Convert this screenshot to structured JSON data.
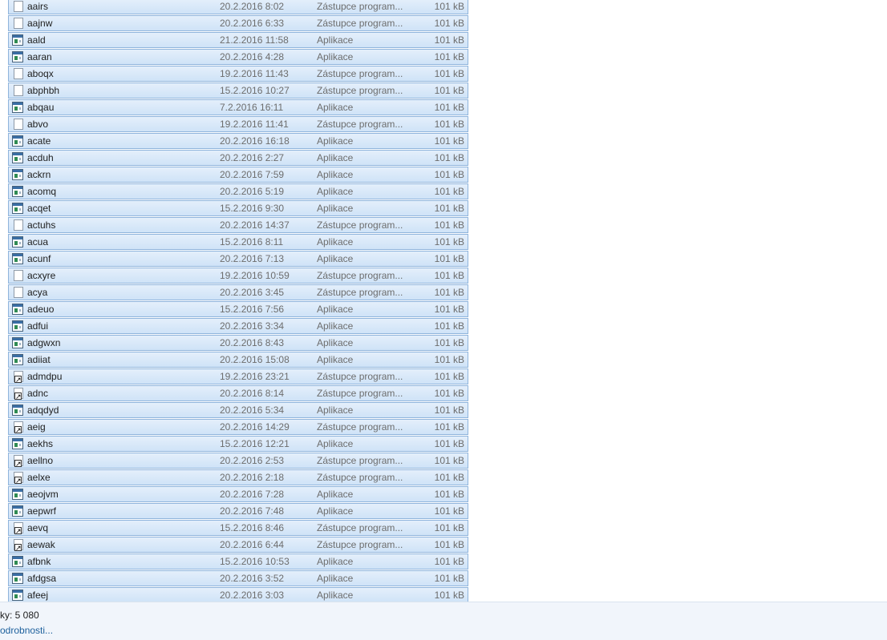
{
  "files": [
    {
      "name": "aairs",
      "date": "20.2.2016 8:02",
      "type": "Zástupce program...",
      "size": "101 kB",
      "icon": "document-icon"
    },
    {
      "name": "aajnw",
      "date": "20.2.2016 6:33",
      "type": "Zástupce program...",
      "size": "101 kB",
      "icon": "document-icon"
    },
    {
      "name": "aald",
      "date": "21.2.2016 11:58",
      "type": "Aplikace",
      "size": "101 kB",
      "icon": "application-icon"
    },
    {
      "name": "aaran",
      "date": "20.2.2016 4:28",
      "type": "Aplikace",
      "size": "101 kB",
      "icon": "application-icon"
    },
    {
      "name": "aboqx",
      "date": "19.2.2016 11:43",
      "type": "Zástupce program...",
      "size": "101 kB",
      "icon": "document-icon"
    },
    {
      "name": "abphbh",
      "date": "15.2.2016 10:27",
      "type": "Zástupce program...",
      "size": "101 kB",
      "icon": "document-icon"
    },
    {
      "name": "abqau",
      "date": "7.2.2016 16:11",
      "type": "Aplikace",
      "size": "101 kB",
      "icon": "application-icon"
    },
    {
      "name": "abvo",
      "date": "19.2.2016 11:41",
      "type": "Zástupce program...",
      "size": "101 kB",
      "icon": "document-icon"
    },
    {
      "name": "acate",
      "date": "20.2.2016 16:18",
      "type": "Aplikace",
      "size": "101 kB",
      "icon": "application-icon"
    },
    {
      "name": "acduh",
      "date": "20.2.2016 2:27",
      "type": "Aplikace",
      "size": "101 kB",
      "icon": "application-icon"
    },
    {
      "name": "ackrn",
      "date": "20.2.2016 7:59",
      "type": "Aplikace",
      "size": "101 kB",
      "icon": "application-icon"
    },
    {
      "name": "acomq",
      "date": "20.2.2016 5:19",
      "type": "Aplikace",
      "size": "101 kB",
      "icon": "application-icon"
    },
    {
      "name": "acqet",
      "date": "15.2.2016 9:30",
      "type": "Aplikace",
      "size": "101 kB",
      "icon": "application-icon"
    },
    {
      "name": "actuhs",
      "date": "20.2.2016 14:37",
      "type": "Zástupce program...",
      "size": "101 kB",
      "icon": "document-icon"
    },
    {
      "name": "acua",
      "date": "15.2.2016 8:11",
      "type": "Aplikace",
      "size": "101 kB",
      "icon": "application-icon"
    },
    {
      "name": "acunf",
      "date": "20.2.2016 7:13",
      "type": "Aplikace",
      "size": "101 kB",
      "icon": "application-icon"
    },
    {
      "name": "acxyre",
      "date": "19.2.2016 10:59",
      "type": "Zástupce program...",
      "size": "101 kB",
      "icon": "document-icon"
    },
    {
      "name": "acya",
      "date": "20.2.2016 3:45",
      "type": "Zástupce program...",
      "size": "101 kB",
      "icon": "document-icon"
    },
    {
      "name": "adeuo",
      "date": "15.2.2016 7:56",
      "type": "Aplikace",
      "size": "101 kB",
      "icon": "application-icon"
    },
    {
      "name": "adfui",
      "date": "20.2.2016 3:34",
      "type": "Aplikace",
      "size": "101 kB",
      "icon": "application-icon"
    },
    {
      "name": "adgwxn",
      "date": "20.2.2016 8:43",
      "type": "Aplikace",
      "size": "101 kB",
      "icon": "application-icon"
    },
    {
      "name": "adiiat",
      "date": "20.2.2016 15:08",
      "type": "Aplikace",
      "size": "101 kB",
      "icon": "application-icon"
    },
    {
      "name": "admdpu",
      "date": "19.2.2016 23:21",
      "type": "Zástupce program...",
      "size": "101 kB",
      "icon": "shortcut-icon"
    },
    {
      "name": "adnc",
      "date": "20.2.2016 8:14",
      "type": "Zástupce program...",
      "size": "101 kB",
      "icon": "shortcut-icon"
    },
    {
      "name": "adqdyd",
      "date": "20.2.2016 5:34",
      "type": "Aplikace",
      "size": "101 kB",
      "icon": "application-icon"
    },
    {
      "name": "aeig",
      "date": "20.2.2016 14:29",
      "type": "Zástupce program...",
      "size": "101 kB",
      "icon": "shortcut-icon"
    },
    {
      "name": "aekhs",
      "date": "15.2.2016 12:21",
      "type": "Aplikace",
      "size": "101 kB",
      "icon": "application-icon"
    },
    {
      "name": "aellno",
      "date": "20.2.2016 2:53",
      "type": "Zástupce program...",
      "size": "101 kB",
      "icon": "shortcut-icon"
    },
    {
      "name": "aelxe",
      "date": "20.2.2016 2:18",
      "type": "Zástupce program...",
      "size": "101 kB",
      "icon": "shortcut-icon"
    },
    {
      "name": "aeojvm",
      "date": "20.2.2016 7:28",
      "type": "Aplikace",
      "size": "101 kB",
      "icon": "application-icon"
    },
    {
      "name": "aepwrf",
      "date": "20.2.2016 7:48",
      "type": "Aplikace",
      "size": "101 kB",
      "icon": "application-icon"
    },
    {
      "name": "aevq",
      "date": "15.2.2016 8:46",
      "type": "Zástupce program...",
      "size": "101 kB",
      "icon": "shortcut-icon"
    },
    {
      "name": "aewak",
      "date": "20.2.2016 6:44",
      "type": "Zástupce program...",
      "size": "101 kB",
      "icon": "shortcut-icon"
    },
    {
      "name": "afbnk",
      "date": "15.2.2016 10:53",
      "type": "Aplikace",
      "size": "101 kB",
      "icon": "application-icon"
    },
    {
      "name": "afdgsa",
      "date": "20.2.2016 3:52",
      "type": "Aplikace",
      "size": "101 kB",
      "icon": "application-icon"
    },
    {
      "name": "afeej",
      "date": "20.2.2016 3:03",
      "type": "Aplikace",
      "size": "101 kB",
      "icon": "application-icon"
    }
  ],
  "status": {
    "count_text": "ky: 5 080",
    "details_link": "odrobnosti..."
  },
  "colors": {
    "selection_bg": "#cfe3f7",
    "selection_border": "#8fb4dc",
    "link": "#1c5f9c"
  }
}
